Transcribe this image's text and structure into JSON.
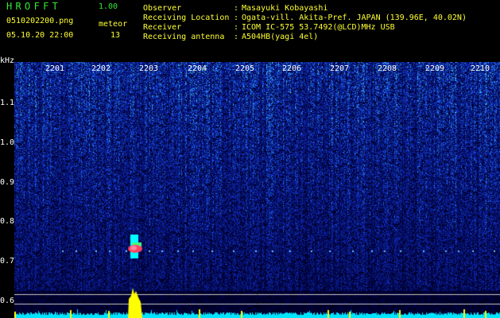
{
  "header": {
    "app_title": "HROFFT",
    "app_version": "1.00",
    "filename": "0510202200.png",
    "datetime": "05.10.20 22:00",
    "meteor_label": "meteor",
    "meteor_count": "13",
    "fields": [
      {
        "label": "Observer",
        "value": "Masayuki Kobayashi"
      },
      {
        "label": "Receiving Location",
        "value": "Ogata-vill. Akita-Pref. JAPAN (139.96E, 40.02N)"
      },
      {
        "label": "Receiver",
        "value": "ICOM IC-575 53.7492(@LCD)MHz USB"
      },
      {
        "label": "Receiving antenna",
        "value": "A504HB(yagi 4el)"
      }
    ]
  },
  "spectrogram": {
    "unit_label": "kHz",
    "freq_ticks": [
      "1.1",
      "1.0",
      "0.9",
      "0.8",
      "0.7",
      "0.6"
    ],
    "time_ticks": [
      "2201",
      "2202",
      "2203",
      "2204",
      "2205",
      "2206",
      "2207",
      "2208",
      "2209",
      "2210"
    ],
    "colors": {
      "background": "#000000",
      "noise": "#1e3cc8",
      "signal": "#ff4060",
      "trace": "#00ffff",
      "burst": "#ffff00"
    }
  }
}
